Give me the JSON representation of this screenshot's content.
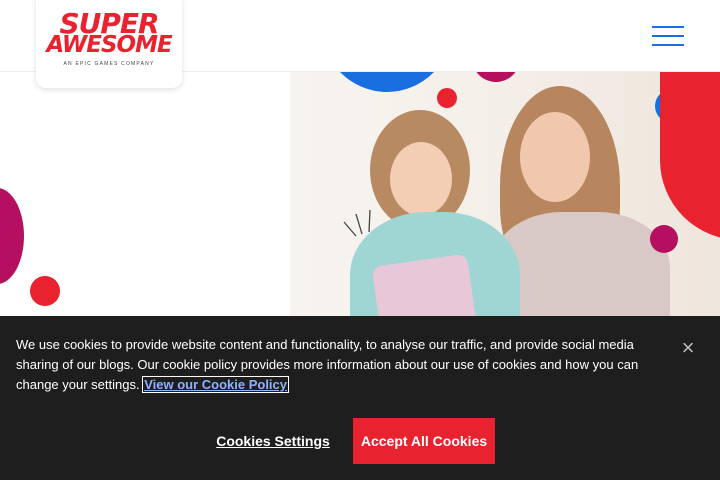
{
  "header": {
    "logo_line1": "SUPER",
    "logo_line2": "AWESOME",
    "logo_sub": "AN EPIC GAMES COMPANY",
    "menu_icon": "hamburger-icon"
  },
  "colors": {
    "brand_red": "#e8232f",
    "brand_blue": "#1a6fe0",
    "magenta": "#b5105f",
    "banner_bg": "#1e1e1e"
  },
  "cookie_banner": {
    "text": "We use cookies to provide website content and functionality, to analyse our traffic, and provide social media sharing of our blogs. Our cookie policy provides more information about our use of cookies and how you can change your settings.",
    "policy_link": "View our Cookie Policy",
    "close_icon": "close-icon",
    "settings_label": "Cookies Settings",
    "accept_label": "Accept All Cookies"
  }
}
